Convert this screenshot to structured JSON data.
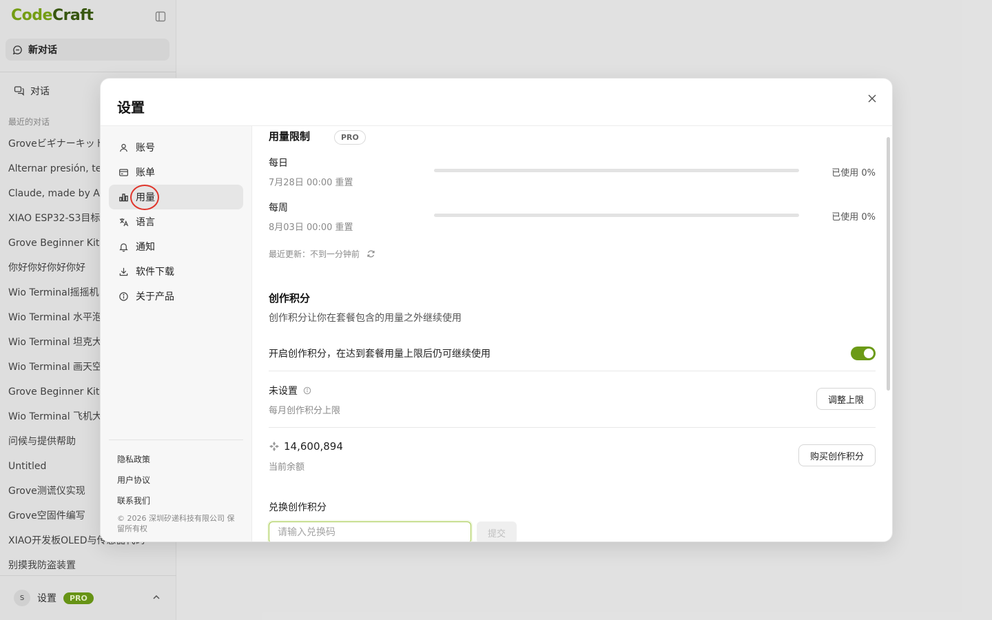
{
  "app": {
    "brand_part1": "Code",
    "brand_part2": "Craft",
    "new_chat_label": "新对话",
    "conversations_label": "对话",
    "recent_label": "最近的对话",
    "recent_conversations": [
      "Groveビギナーキット",
      "Alternar presión, ter",
      "Claude, made by An",
      "XIAO ESP32-S3目标",
      "Grove Beginner Kit",
      "你好你好你好你好",
      "Wio Terminal摇摇机",
      "Wio Terminal 水平泡",
      "Wio Terminal 坦克大",
      "Wio Terminal 画天空",
      "Grove Beginner Kit",
      "Wio Terminal 飞机大",
      "问候与提供帮助",
      "Untitled",
      "Grove测谎仪实现",
      "Grove空固件编写",
      "XIAO开发板OLED与传感器代码",
      "别摸我防盗装置"
    ],
    "user_initial": "S",
    "user_label": "设置",
    "user_badge": "PRO"
  },
  "settings": {
    "title": "设置",
    "nav": [
      {
        "label": "账号",
        "icon": "user-icon"
      },
      {
        "label": "账单",
        "icon": "credit-card-icon"
      },
      {
        "label": "用量",
        "icon": "bar-chart-icon"
      },
      {
        "label": "语言",
        "icon": "translate-icon"
      },
      {
        "label": "通知",
        "icon": "bell-icon"
      },
      {
        "label": "软件下载",
        "icon": "download-icon"
      },
      {
        "label": "关于产品",
        "icon": "info-icon"
      }
    ],
    "active_nav": "用量",
    "footer_links": [
      "隐私政策",
      "用户协议",
      "联系我们"
    ],
    "copyright": "© 2026 深圳矽递科技有限公司 保留所有权"
  },
  "usage": {
    "section_title": "用量限制",
    "plan_badge": "PRO",
    "daily": {
      "label": "每日",
      "reset": "7月28日 00:00 重置",
      "used_text": "已使用 0%",
      "used_fraction": 0
    },
    "weekly": {
      "label": "每周",
      "reset": "8月03日 00:00 重置",
      "used_text": "已使用 0%",
      "used_fraction": 0
    },
    "last_updated": "最近更新：不到一分钟前"
  },
  "credits": {
    "section_title": "创作积分",
    "description": "创作积分让你在套餐包含的用量之外继续使用",
    "toggle_label": "开启创作积分，在达到套餐用量上限后仍可继续使用",
    "toggle_on": true,
    "limit_value": "未设置",
    "limit_caption": "每月创作积分上限",
    "adjust_button": "调整上限",
    "balance": "14,600,894",
    "balance_caption": "当前余额",
    "buy_button": "购买创作积分",
    "redeem_title": "兑换创作积分",
    "redeem_placeholder": "请输入兑换码",
    "submit_button": "提交"
  },
  "colors": {
    "accent": "#6b9a16",
    "brand_light": "#7aa515",
    "highlight_ring": "#e0352b"
  }
}
